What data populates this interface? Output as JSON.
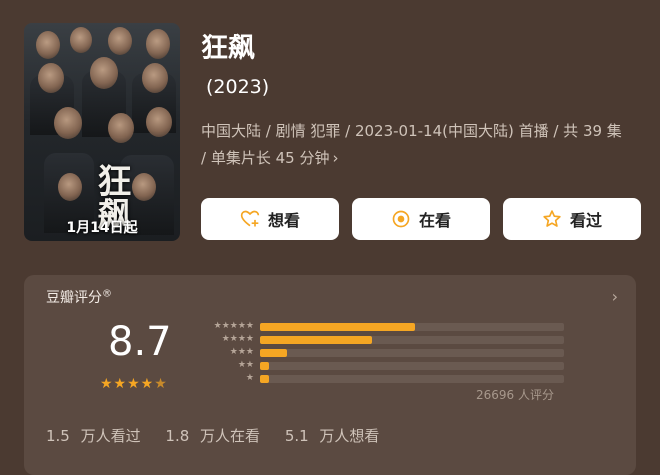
{
  "movie": {
    "title": "狂飙",
    "year": "(2023)",
    "meta": "中国大陆 / 剧情 犯罪 / 2023-01-14(中国大陆) 首播 / 共 39 集 / 单集片长 45 分钟",
    "meta_chevron": "›",
    "poster": {
      "vertical_title": "狂飙",
      "date_text": "1月14日起"
    }
  },
  "actions": [
    {
      "label": "想看",
      "icon": "heart-plus-icon"
    },
    {
      "label": "在看",
      "icon": "circle-dot-icon"
    },
    {
      "label": "看过",
      "icon": "star-outline-icon"
    }
  ],
  "rating": {
    "header": "豆瓣评分",
    "header_mark": "®",
    "chevron": "›",
    "score": "8.7",
    "stars_full": "★★★★",
    "stars_half": "★",
    "distribution": [
      {
        "stars": "★★★★★",
        "fraction": 0.51
      },
      {
        "stars": "★★★★",
        "fraction": 0.37
      },
      {
        "stars": "★★★",
        "fraction": 0.09
      },
      {
        "stars": "★★",
        "fraction": 0.03
      },
      {
        "stars": "★",
        "fraction": 0.03
      }
    ],
    "count": "26696 人评分",
    "watch_stats": [
      "1.5 万人看过",
      "1.8 万人在看",
      "5.1 万人想看"
    ]
  },
  "colors": {
    "background": "#4b3a31",
    "card": "#5b4a41",
    "accent": "#f5a623"
  }
}
